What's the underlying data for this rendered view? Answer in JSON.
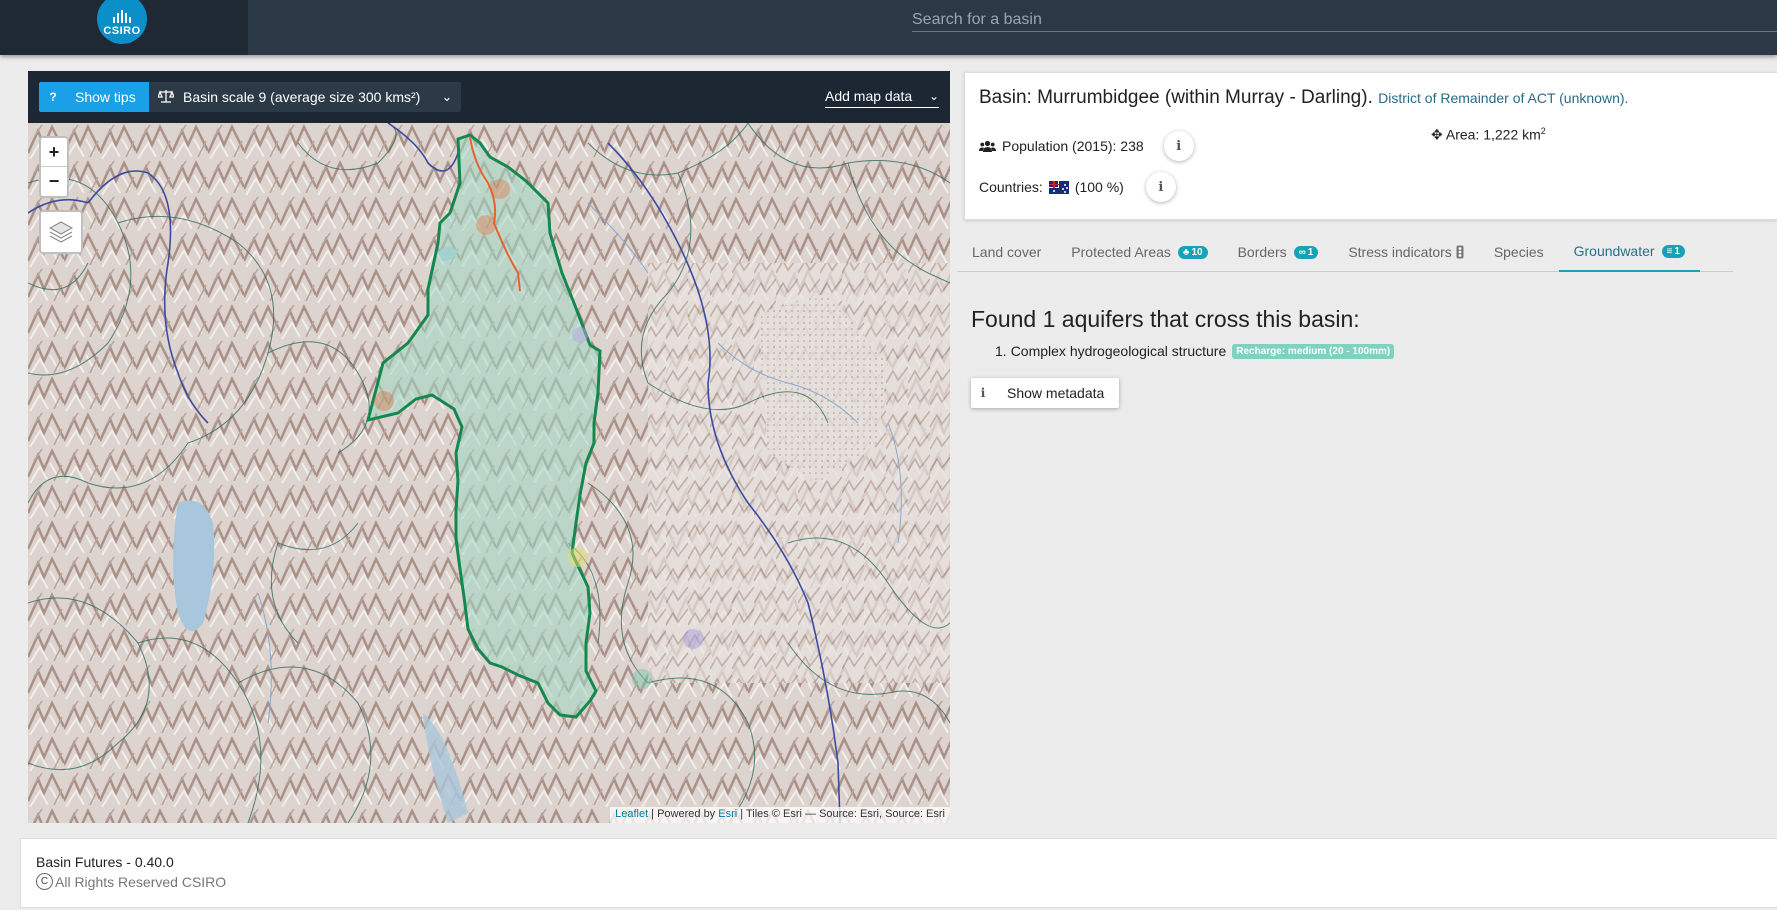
{
  "header": {
    "logo_text": "CSIRO",
    "search_placeholder": "Search for a basin"
  },
  "map_toolbar": {
    "tips_label": "Show tips",
    "tips_icon": "question-icon",
    "scale_label": "Basin scale 9 (average size 300 kms²)",
    "scale_icon": "balance-scale-icon",
    "add_map_data_label": "Add map data"
  },
  "map": {
    "zoom_in": "+",
    "zoom_out": "−",
    "attribution": {
      "leaflet": "Leaflet",
      "powered_by": " | Powered by ",
      "esri": "Esri",
      "tiles": " | Tiles © Esri — Source: Esri, Source: Esri"
    },
    "colors": {
      "basin_outline": "#14884f",
      "basin_fill": "#9ed9c4",
      "river": "#e8622f",
      "road": "#3b4ba0",
      "boundaries": "#2f6b5a"
    }
  },
  "basin": {
    "title": "Basin: Murrumbidgee (within Murray - Darling).",
    "district": "District of Remainder of ACT (unknown).",
    "population_label": "Population (2015): 238",
    "area_label": "Area: 1,222 km",
    "area_sup": "2",
    "countries_label": "Countries:",
    "countries_pct": "(100 %)",
    "info_glyph": "i"
  },
  "tabs": [
    {
      "label": "Land cover",
      "badge": ""
    },
    {
      "label": "Protected Areas",
      "badge": "10",
      "badge_icon": "leaf-icon"
    },
    {
      "label": "Borders",
      "badge": "1",
      "badge_icon": "link-icon"
    },
    {
      "label": "Stress indicators",
      "badge": "",
      "badge_icon": "traffic-light-icon"
    },
    {
      "label": "Species",
      "badge": ""
    },
    {
      "label": "Groundwater",
      "badge": "1",
      "badge_icon": "water-icon",
      "active": true
    }
  ],
  "groundwater": {
    "heading": "Found 1 aquifers that cross this basin:",
    "item_number": "1.",
    "item_label": "Complex hydrogeological structure",
    "recharge_label": "Recharge: medium (20 - 100mm)",
    "metadata_button": "Show metadata"
  },
  "footer": {
    "version": "Basin Futures - 0.40.0",
    "copyright_symbol": "C",
    "rights": "All Rights Reserved CSIRO"
  }
}
